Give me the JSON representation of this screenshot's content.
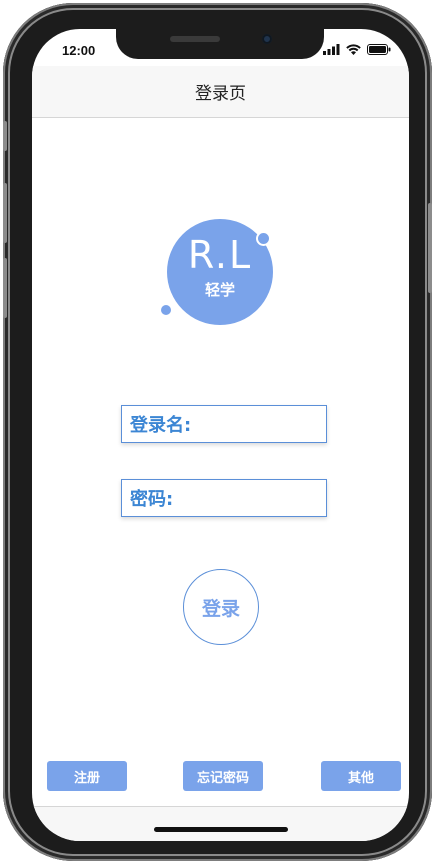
{
  "status_bar": {
    "time": "12:00",
    "icons": [
      "signal-icon",
      "wifi-icon",
      "battery-icon"
    ]
  },
  "nav": {
    "title": "登录页"
  },
  "logo": {
    "letters": "R.L",
    "subtitle": "轻学"
  },
  "form": {
    "username_label": "登录名:",
    "username_value": "",
    "password_label": "密码:",
    "password_value": ""
  },
  "login_button": {
    "label": "登录"
  },
  "bottom_buttons": {
    "register": "注册",
    "forgot_password": "忘记密码",
    "other": "其他"
  },
  "colors": {
    "accent": "#7aa3ea",
    "label_blue": "#3c86d4",
    "border_blue": "#5b8fd8"
  }
}
